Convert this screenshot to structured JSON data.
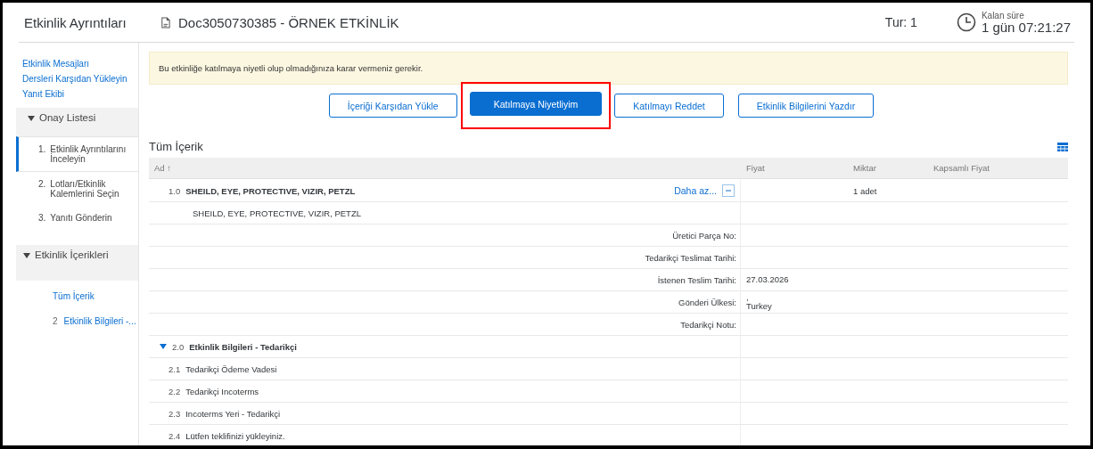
{
  "header": {
    "title": "Etkinlik Ayrıntıları",
    "document": "Doc3050730385 - ÖRNEK ETKİNLİK",
    "round": "Tur: 1",
    "remaining_label": "Kalan süre",
    "remaining_time": "1 gün 07:21:27"
  },
  "sidebar": {
    "links": [
      "Etkinlik Mesajları",
      "Dersleri Karşıdan Yükleyin",
      "Yanıt Ekibi"
    ],
    "checklist": {
      "title": "Onay Listesi",
      "expanded": true,
      "steps": [
        {
          "number": "1.",
          "label": "Etkinlik Ayrıntılarını İnceleyin",
          "selected": true
        },
        {
          "number": "2.",
          "label": "Lotları/Etkinlik Kalemlerini Seçin",
          "selected": false
        },
        {
          "number": "3.",
          "label": "Yanıtı Gönderin",
          "selected": false
        }
      ]
    },
    "contents": {
      "title": "Etkinlik İçerikleri",
      "expanded": true,
      "items": [
        {
          "label": "Tüm İçerik"
        },
        {
          "number": "2",
          "label": "Etkinlik Bilgileri -..."
        }
      ]
    }
  },
  "notice": "Bu etkinliğe katılmaya niyetli olup olmadığınıza karar vermeniz gerekir.",
  "buttons": [
    {
      "label": "İçeriği Karşıdan Yükle",
      "primary": false,
      "highlighted": false
    },
    {
      "label": "Katılmaya Niyetliyim",
      "primary": true,
      "highlighted": true
    },
    {
      "label": "Katılmayı Reddet",
      "primary": false,
      "highlighted": false
    },
    {
      "label": "Etkinlik Bilgilerini Yazdır",
      "primary": false,
      "highlighted": false
    }
  ],
  "table": {
    "title": "Tüm İçerik",
    "columns": [
      "Ad ↑",
      "Fiyat",
      "Miktar",
      "Kapsamlı Fiyat"
    ],
    "rows": [
      {
        "kind": "item",
        "number": "1.0",
        "name": "SHEILD, EYE, PROTECTIVE, VIZIR, PETZL",
        "link": "Daha az...",
        "price": "",
        "quantity": "1 adet",
        "extended_price": ""
      },
      {
        "kind": "description",
        "text": "SHEILD, EYE, PROTECTIVE, VIZIR, PETZL"
      },
      {
        "kind": "field",
        "label": "Üretici Parça No:",
        "value": ""
      },
      {
        "kind": "field",
        "label": "Tedarikçi Teslimat Tarihi:",
        "value": ""
      },
      {
        "kind": "field",
        "label": "İstenen Teslim Tarihi:",
        "value": "27.03.2026"
      },
      {
        "kind": "field",
        "label": "Gönderi Ülkesi:",
        "value": ",\nTurkey"
      },
      {
        "kind": "field",
        "label": "Tedarikçi Notu:",
        "value": ""
      },
      {
        "kind": "group",
        "number": "2.0",
        "name": "Etkinlik Bilgileri - Tedarikçi",
        "expanded": true
      },
      {
        "kind": "subitem",
        "number": "2.1",
        "name": "Tedarikçi Ödeme Vadesi"
      },
      {
        "kind": "subitem",
        "number": "2.2",
        "name": "Tedarikçi Incoterms"
      },
      {
        "kind": "subitem",
        "number": "2.3",
        "name": "Incoterms Yeri - Tedarikçi"
      },
      {
        "kind": "subitem",
        "number": "2.4",
        "name": "Lütfen teklifinizi yükleyiniz."
      }
    ]
  }
}
